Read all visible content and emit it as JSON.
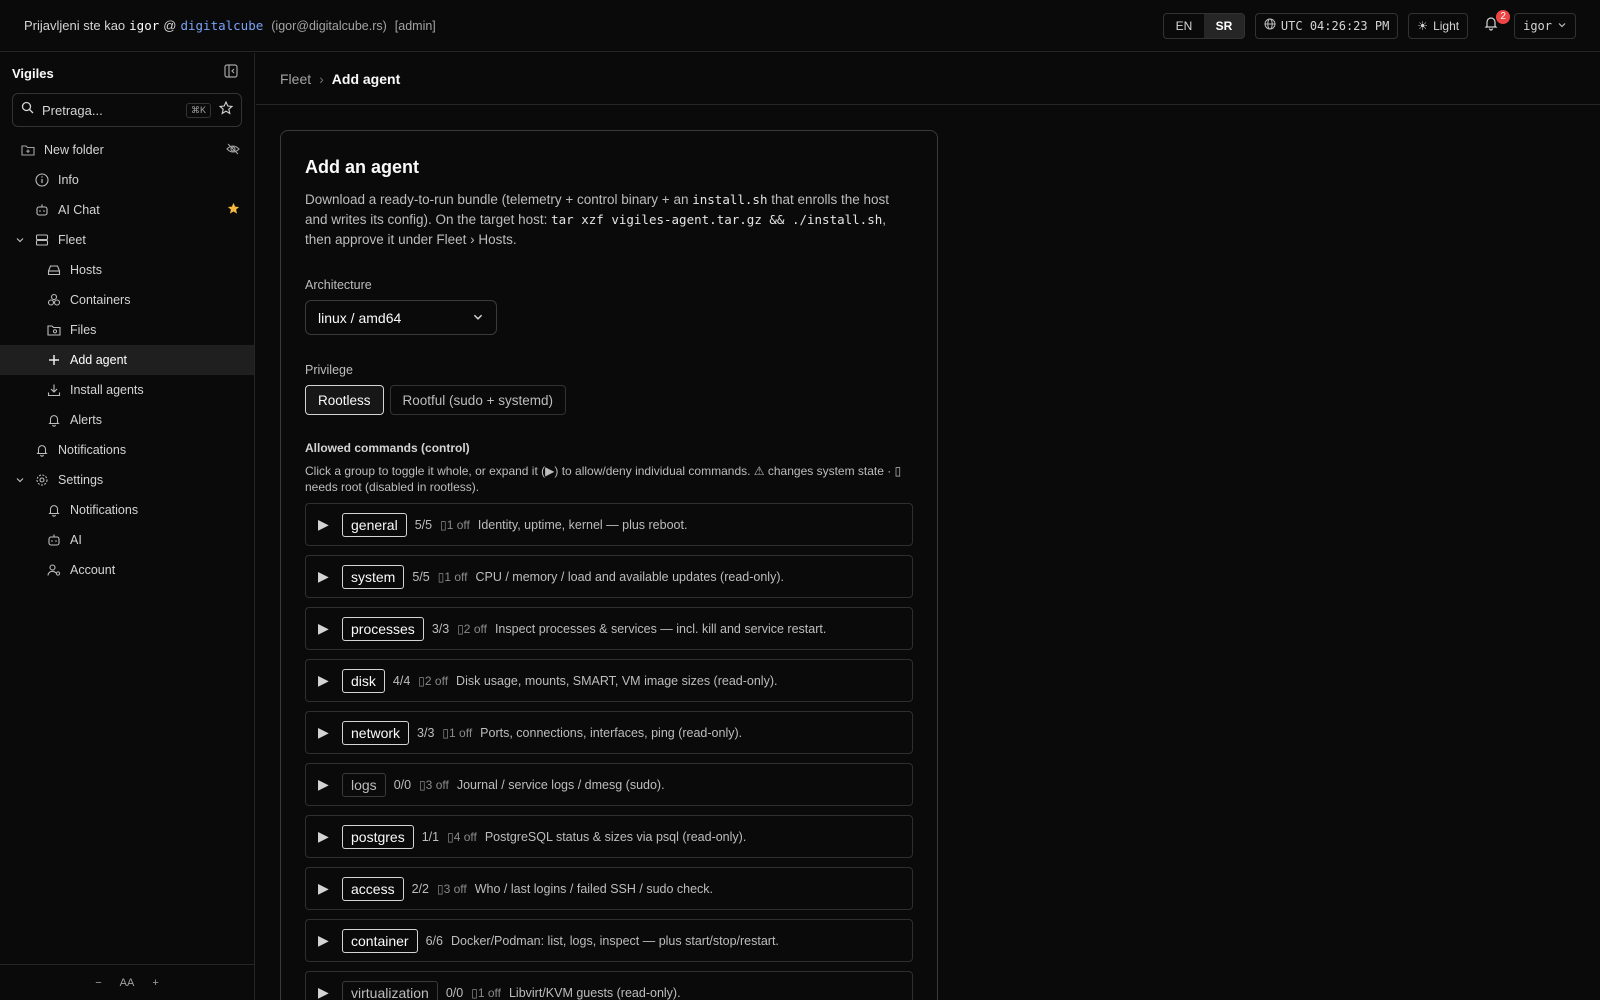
{
  "topbar": {
    "logged_as": "Prijavljeni ste kao",
    "user": "igor",
    "at": "@",
    "org": "digitalcube",
    "email": "(igor@digitalcube.rs)",
    "role": "[admin]",
    "lang_en": "EN",
    "lang_sr": "SR",
    "clock": "UTC 04:26:23 PM",
    "theme": "Light",
    "notif_count": "2",
    "user_menu": "igor"
  },
  "sidebar": {
    "brand": "Vigiles",
    "search_placeholder": "Pretraga...",
    "search_kbd": "⌘K",
    "folder": "New folder",
    "items": [
      {
        "label": "Info"
      },
      {
        "label": "AI Chat"
      },
      {
        "label": "Fleet"
      },
      {
        "label": "Hosts"
      },
      {
        "label": "Containers"
      },
      {
        "label": "Files"
      },
      {
        "label": "Add agent"
      },
      {
        "label": "Install agents"
      },
      {
        "label": "Alerts"
      },
      {
        "label": "Notifications"
      },
      {
        "label": "Settings"
      },
      {
        "label": "Notifications"
      },
      {
        "label": "AI"
      },
      {
        "label": "Account"
      }
    ],
    "footer": {
      "minus": "−",
      "aa": "AA",
      "plus": "+"
    }
  },
  "breadcrumb": {
    "parent": "Fleet",
    "sep": "›",
    "current": "Add agent"
  },
  "card": {
    "title": "Add an agent",
    "desc_1": "Download a ready-to-run bundle (telemetry + control binary + an ",
    "desc_code1": "install.sh",
    "desc_2": " that enrolls the host and writes its config). On the target host: ",
    "desc_code2": "tar xzf vigiles-agent.tar.gz && ./install.sh",
    "desc_3": ", then approve it under Fleet › Hosts.",
    "arch_label": "Architecture",
    "arch_value": "linux / amd64",
    "priv_label": "Privilege",
    "priv_rootless": "Rootless",
    "priv_rootful": "Rootful (sudo + systemd)",
    "cmd_title": "Allowed commands (control)",
    "cmd_hint": "Click a group to toggle it whole, or expand it (▶) to allow/deny individual commands. ⚠ changes system state · ▯ needs root (disabled in rootless)."
  },
  "groups": [
    {
      "name": "general",
      "count": "5/5",
      "off": "▯1 off",
      "desc": "Identity, uptime, kernel — plus reboot.",
      "enabled": true
    },
    {
      "name": "system",
      "count": "5/5",
      "off": "▯1 off",
      "desc": "CPU / memory / load and available updates (read-only).",
      "enabled": true
    },
    {
      "name": "processes",
      "count": "3/3",
      "off": "▯2 off",
      "desc": "Inspect processes & services — incl. kill and service restart.",
      "enabled": true
    },
    {
      "name": "disk",
      "count": "4/4",
      "off": "▯2 off",
      "desc": "Disk usage, mounts, SMART, VM image sizes (read-only).",
      "enabled": true
    },
    {
      "name": "network",
      "count": "3/3",
      "off": "▯1 off",
      "desc": "Ports, connections, interfaces, ping (read-only).",
      "enabled": true
    },
    {
      "name": "logs",
      "count": "0/0",
      "off": "▯3 off",
      "desc": "Journal / service logs / dmesg (sudo).",
      "enabled": false
    },
    {
      "name": "postgres",
      "count": "1/1",
      "off": "▯4 off",
      "desc": "PostgreSQL status & sizes via psql (read-only).",
      "enabled": true
    },
    {
      "name": "access",
      "count": "2/2",
      "off": "▯3 off",
      "desc": "Who / last logins / failed SSH / sudo check.",
      "enabled": true
    },
    {
      "name": "container",
      "count": "6/6",
      "off": "",
      "desc": "Docker/Podman: list, logs, inspect — plus start/stop/restart.",
      "enabled": true
    },
    {
      "name": "virtualization",
      "count": "0/0",
      "off": "▯1 off",
      "desc": "Libvirt/KVM guests (read-only).",
      "enabled": false
    }
  ],
  "colors": {
    "accent_org": "#7aa2f7",
    "badge": "#ef4444",
    "star": "#f5b942"
  }
}
